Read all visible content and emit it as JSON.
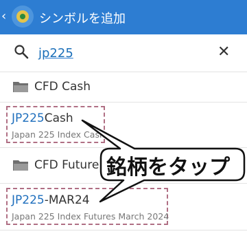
{
  "appbar": {
    "back_glyph": "‹",
    "title": "シンボルを追加"
  },
  "search": {
    "query": "jp225"
  },
  "groups": [
    {
      "label": "CFD Cash"
    },
    {
      "label": "CFD Future"
    }
  ],
  "items": [
    {
      "symbol_match": "JP225",
      "symbol_rest": "Cash",
      "description": "Japan 225 Index Cash"
    },
    {
      "symbol_match": "JP225",
      "symbol_rest": "-MAR24",
      "description": "Japan 225 Index Futures March 2024"
    }
  ],
  "callout": {
    "text": "銘柄をタップ"
  },
  "colors": {
    "appbar": "#2d7dd2",
    "highlight": "#1f6fbd",
    "dashed_border": "#b06f84"
  }
}
